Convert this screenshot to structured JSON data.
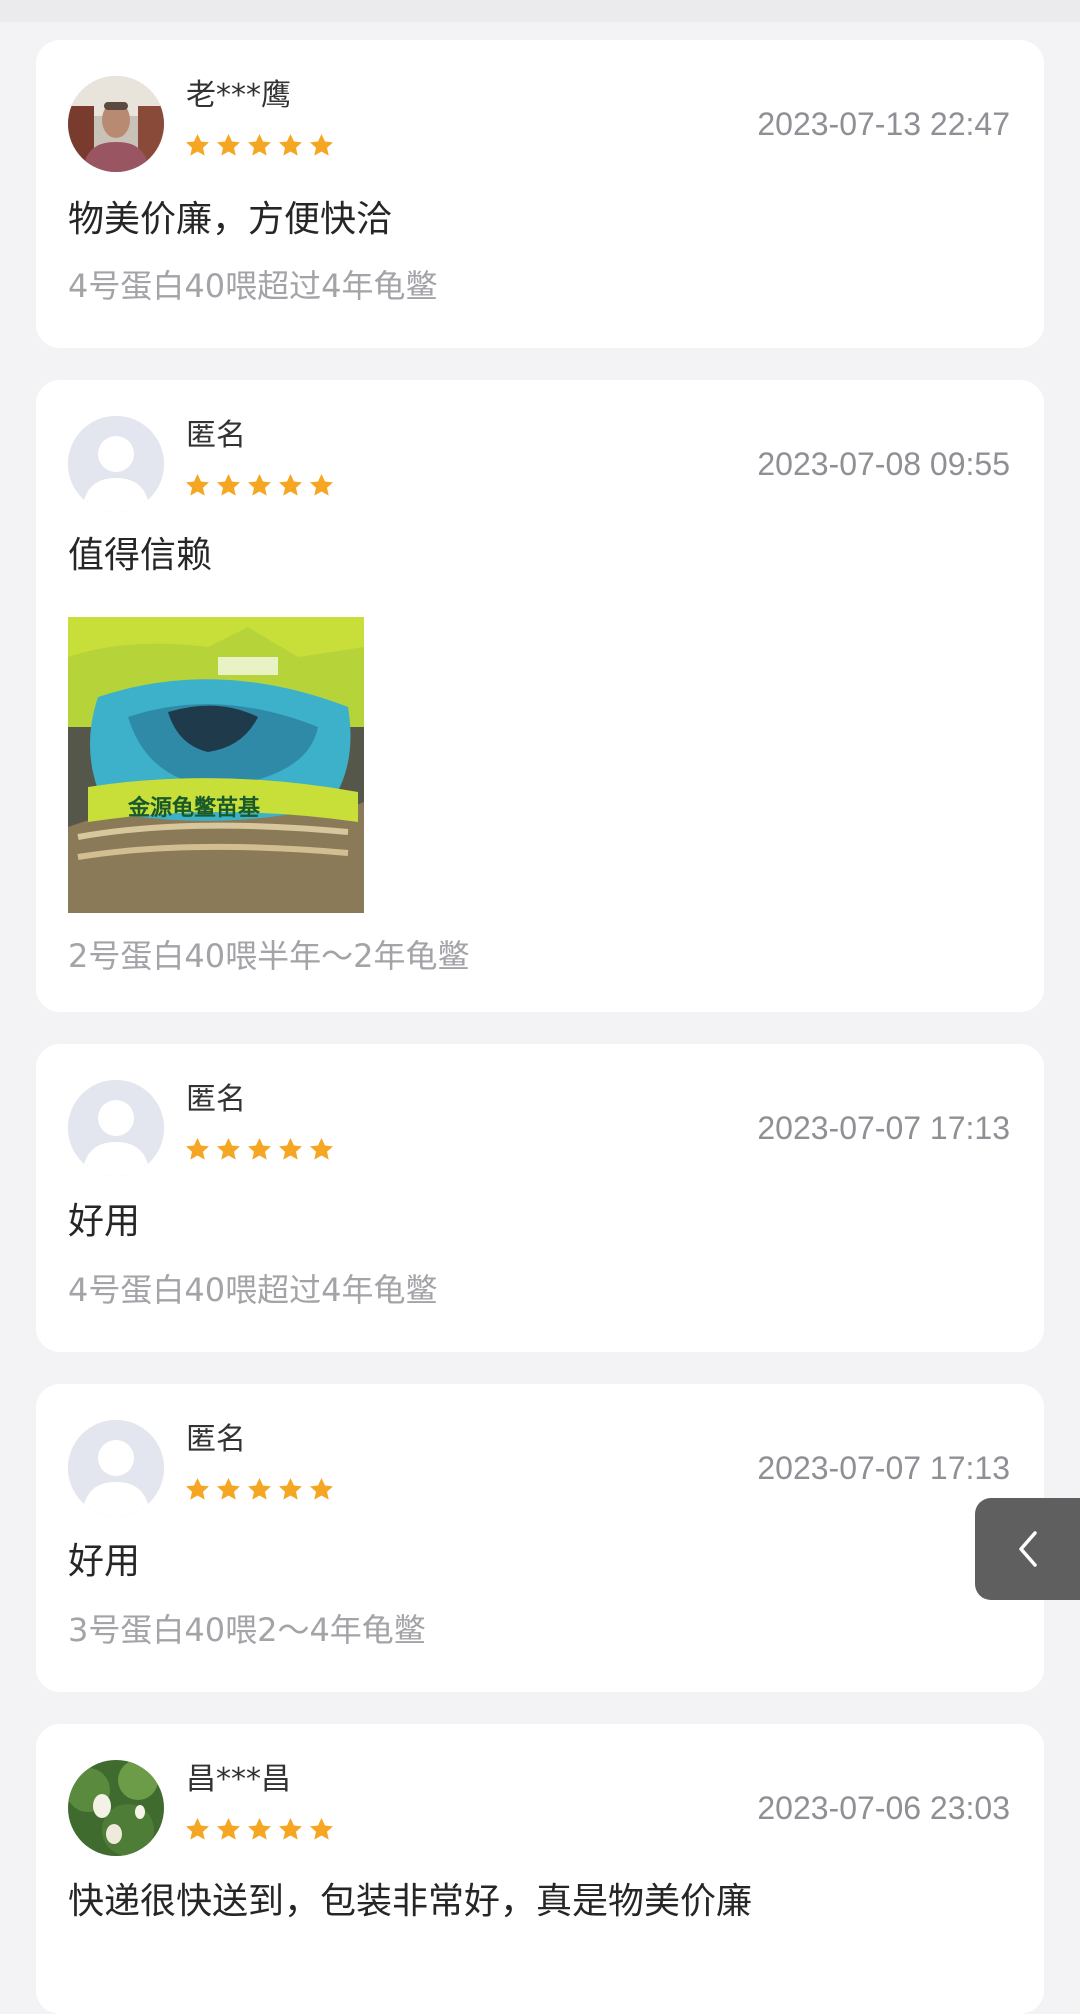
{
  "reviews": [
    {
      "user": "老***鹰",
      "rating": 5,
      "date": "2023-07-13 22:47",
      "text": "物美价廉，方便快洽",
      "spec": "4号蛋白40喂超过4年龟鳖",
      "avatar": "man-photo",
      "has_photo": false
    },
    {
      "user": "匿名",
      "rating": 5,
      "date": "2023-07-08 09:55",
      "text": "值得信赖",
      "spec": "2号蛋白40喂半年～2年龟鳖",
      "avatar": "default-user",
      "has_photo": true,
      "photo_text": "金源龟鳖苗基"
    },
    {
      "user": "匿名",
      "rating": 5,
      "date": "2023-07-07 17:13",
      "text": "好用",
      "spec": "4号蛋白40喂超过4年龟鳖",
      "avatar": "default-user",
      "has_photo": false
    },
    {
      "user": "匿名",
      "rating": 5,
      "date": "2023-07-07 17:13",
      "text": "好用",
      "spec": "3号蛋白40喂2～4年龟鳖",
      "avatar": "default-user",
      "has_photo": false
    },
    {
      "user": "昌***昌",
      "rating": 5,
      "date": "2023-07-06 23:03",
      "text": "快递很快送到，包装非常好，真是物美价廉",
      "avatar": "lotus-photo",
      "has_photo": false
    }
  ],
  "colors": {
    "star": "#f5a623",
    "background": "#f3f3f5",
    "card": "#ffffff",
    "side_button": "#5f5f5f"
  },
  "side_button": {
    "icon": "chevron-left-icon"
  }
}
